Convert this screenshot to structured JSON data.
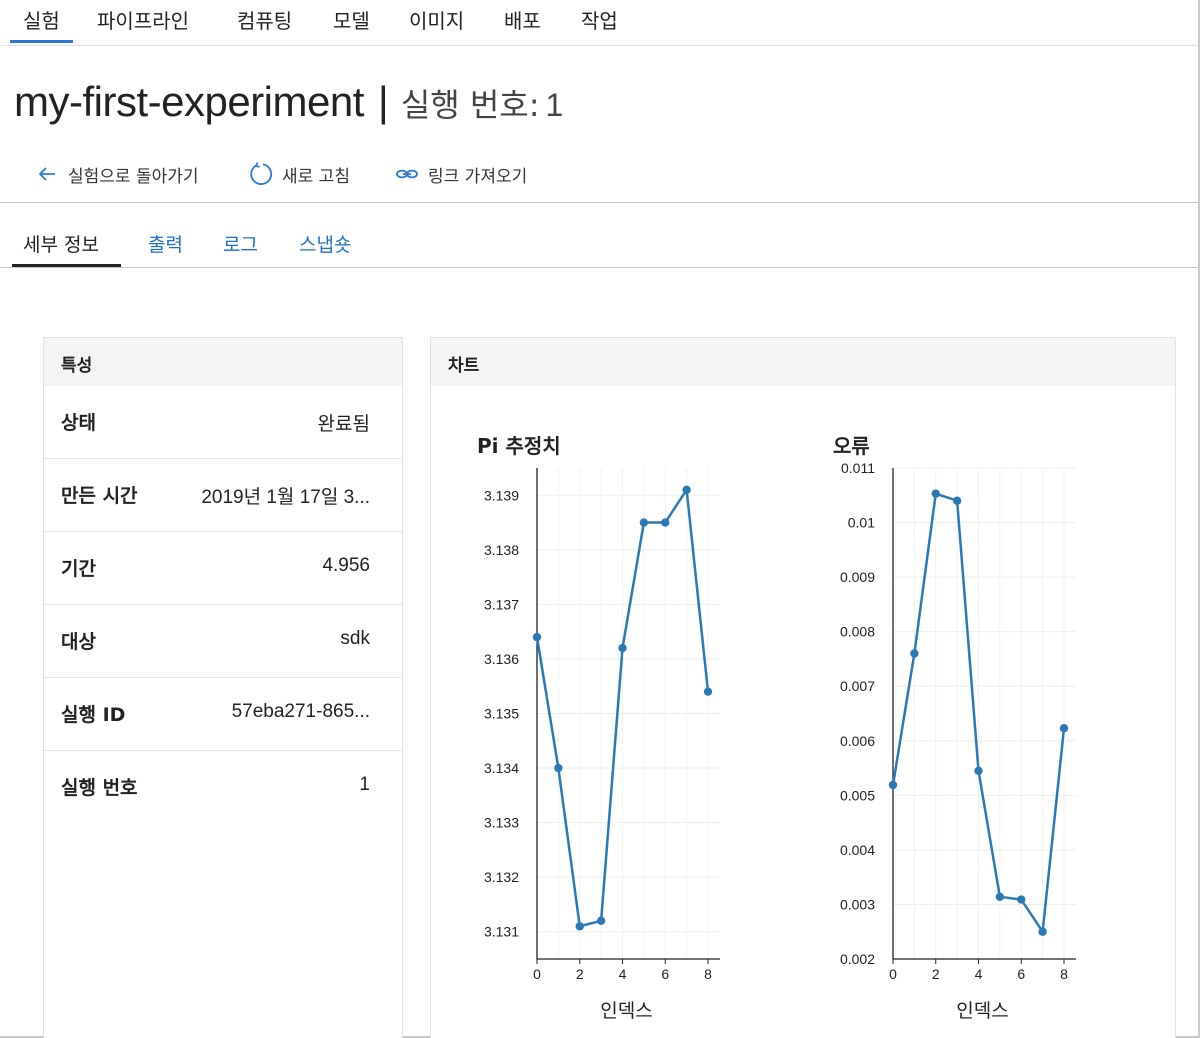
{
  "nav": {
    "items": [
      "실험",
      "파이프라인",
      "컴퓨팅",
      "모델",
      "이미지",
      "배포",
      "작업"
    ],
    "active_index": 0
  },
  "header": {
    "experiment_name": "my-first-experiment",
    "separator": "|",
    "run_label": "실행 번호:",
    "run_number": "1"
  },
  "commands": {
    "back_label": "실험으로 돌아가기",
    "refresh_label": "새로 고침",
    "link_label": "링크 가져오기"
  },
  "tabs": [
    "세부 정보",
    "출력",
    "로그",
    "스냅숏"
  ],
  "active_tab": 0,
  "properties": {
    "title": "특성",
    "rows": [
      {
        "label": "상태",
        "value": "완료됨"
      },
      {
        "label": "만든 시간",
        "value": "2019년 1월 17일 3..."
      },
      {
        "label": "기간",
        "value": "4.956"
      },
      {
        "label": "대상",
        "value": "sdk"
      },
      {
        "label": "실행 ID",
        "value": "57eba271-865..."
      },
      {
        "label": "실행 번호",
        "value": "1"
      }
    ]
  },
  "charts_panel": {
    "title": "차트"
  },
  "colors": {
    "accent": "#2a7ad1",
    "link": "#1f6fc5",
    "series": "#2b79b4",
    "panel_header": "#f4f4f4"
  },
  "chart_data": [
    {
      "type": "line",
      "title": "Pi 추정치",
      "xlabel": "인덱스",
      "ylabel": "",
      "x": [
        0,
        1,
        2,
        3,
        4,
        5,
        6,
        7,
        8
      ],
      "values": [
        3.1364,
        3.134,
        3.1311,
        3.1312,
        3.1362,
        3.1385,
        3.1385,
        3.1391,
        3.1354
      ],
      "xlim": [
        0,
        8
      ],
      "ylim": [
        3.1305,
        3.1395
      ],
      "xticks": [
        0,
        2,
        4,
        6,
        8
      ],
      "yticks": [
        3.131,
        3.132,
        3.133,
        3.134,
        3.135,
        3.136,
        3.137,
        3.138,
        3.139
      ],
      "ytick_labels": [
        "3.131",
        "3.132",
        "3.133",
        "3.134",
        "3.135",
        "3.136",
        "3.137",
        "3.138",
        "3.139"
      ],
      "grid": true
    },
    {
      "type": "line",
      "title": "오류",
      "xlabel": "인덱스",
      "ylabel": "",
      "x": [
        0,
        1,
        2,
        3,
        4,
        5,
        6,
        7,
        8
      ],
      "values": [
        0.00519,
        0.0076,
        0.01053,
        0.0104,
        0.00545,
        0.00314,
        0.00309,
        0.0025,
        0.00623
      ],
      "xlim": [
        0,
        8
      ],
      "ylim": [
        0.002,
        0.011
      ],
      "xticks": [
        0,
        2,
        4,
        6,
        8
      ],
      "yticks": [
        0.002,
        0.003,
        0.004,
        0.005,
        0.006,
        0.007,
        0.008,
        0.009,
        0.01,
        0.011
      ],
      "ytick_labels": [
        "0.002",
        "0.003",
        "0.004",
        "0.005",
        "0.006",
        "0.007",
        "0.008",
        "0.009",
        "0.01",
        "0.011"
      ],
      "grid": true
    }
  ]
}
